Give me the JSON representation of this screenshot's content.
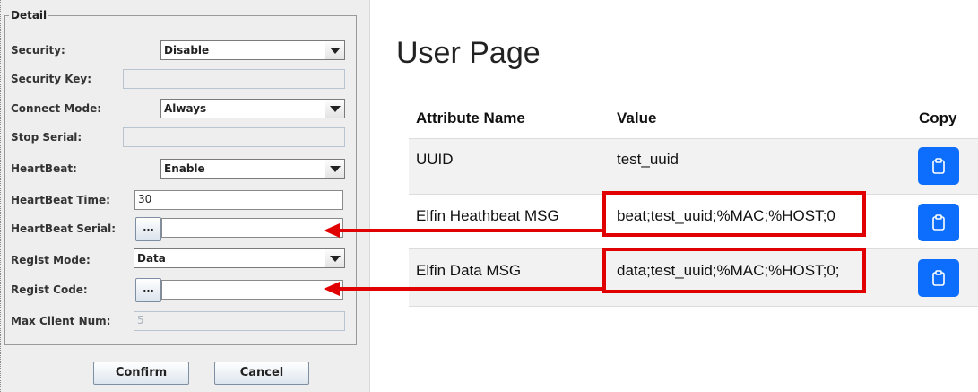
{
  "dialog": {
    "group_title": "Detail",
    "security": {
      "label": "Security:",
      "value": "Disable"
    },
    "security_key": {
      "label": "Security Key:",
      "value": ""
    },
    "connect_mode": {
      "label": "Connect Mode:",
      "value": "Always"
    },
    "stop_serial": {
      "label": "Stop Serial:",
      "value": ""
    },
    "heartbeat": {
      "label": "HeartBeat:",
      "value": "Enable"
    },
    "heartbeat_time": {
      "label": "HeartBeat Time:",
      "value": "30"
    },
    "heartbeat_serial": {
      "label": "HeartBeat Serial:",
      "button": "...",
      "value": ""
    },
    "regist_mode": {
      "label": "Regist Mode:",
      "value": "Data"
    },
    "regist_code": {
      "label": "Regist Code:",
      "button": "...",
      "value": ""
    },
    "max_client_num": {
      "label": "Max Client Num:",
      "value": "5"
    },
    "confirm_label": "Confirm",
    "cancel_label": "Cancel"
  },
  "user_page": {
    "title": "User Page",
    "columns": [
      "Attribute Name",
      "Value",
      "Copy"
    ],
    "rows": [
      {
        "name": "UUID",
        "value": "test_uuid"
      },
      {
        "name": "Elfin Heathbeat MSG",
        "value": "beat;test_uuid;%MAC;%HOST;0"
      },
      {
        "name": "Elfin Data MSG",
        "value": "data;test_uuid;%MAC;%HOST;0;"
      }
    ],
    "copy_icon": "clipboard-icon"
  },
  "colors": {
    "highlight": "#e00000",
    "copy_button": "#0d6efd",
    "dialog_bg": "#eeeeee"
  }
}
